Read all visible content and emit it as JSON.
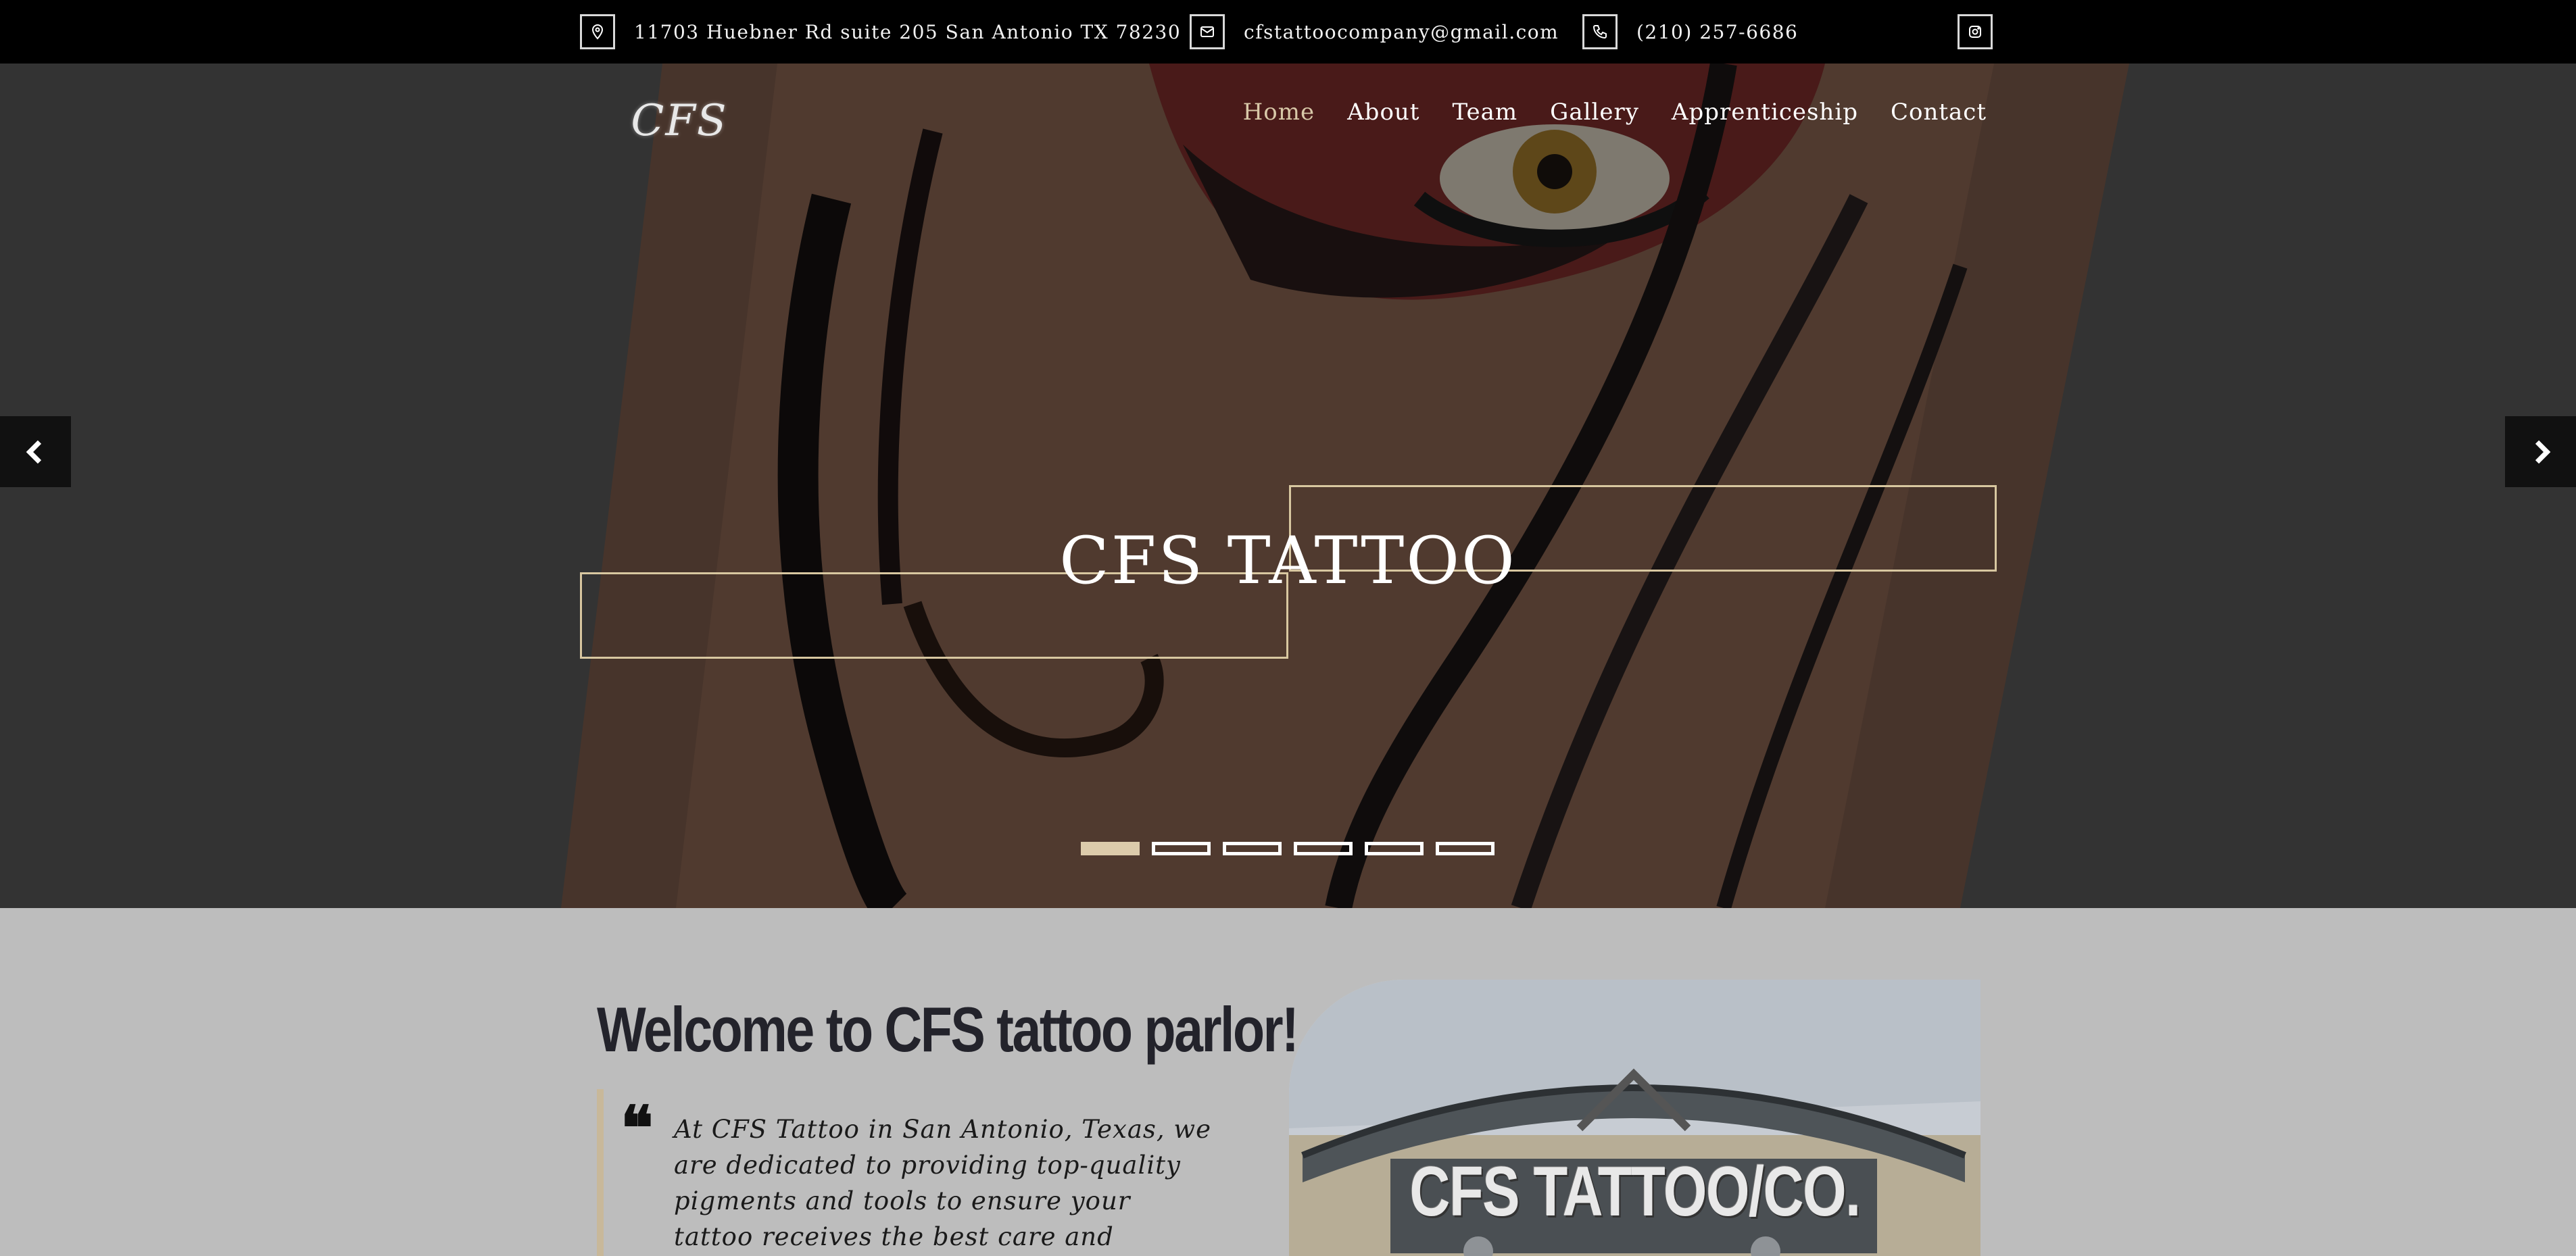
{
  "topbar": {
    "address": "11703 Huebner Rd suite 205 San Antonio TX 78230",
    "email": "cfstattoocompany@gmail.com",
    "phone": "(210) 257-6686",
    "icons": [
      "map-pin-icon",
      "mail-icon",
      "phone-icon",
      "instagram-icon"
    ]
  },
  "header": {
    "logo": "CFS",
    "nav": [
      "Home",
      "About",
      "Team",
      "Gallery",
      "Apprenticeship",
      "Contact"
    ],
    "active_nav": "Home"
  },
  "hero": {
    "title": "CFS TATTOO",
    "slide_count": 6,
    "active_slide": 1
  },
  "welcome": {
    "title": "Welcome to CFS tattoo parlor!",
    "quote_mark": "❝",
    "quote": "At CFS Tattoo in San Antonio, Texas, we are dedicated to providing top-quality pigments and tools to ensure your tattoo receives the best care and",
    "photo_sign": "CFS TATTOO/CO."
  },
  "colors": {
    "accent": "#d8c7a0",
    "topbar_bg": "#000000",
    "section_bg": "#bdbdbd",
    "heading": "#23232b"
  }
}
